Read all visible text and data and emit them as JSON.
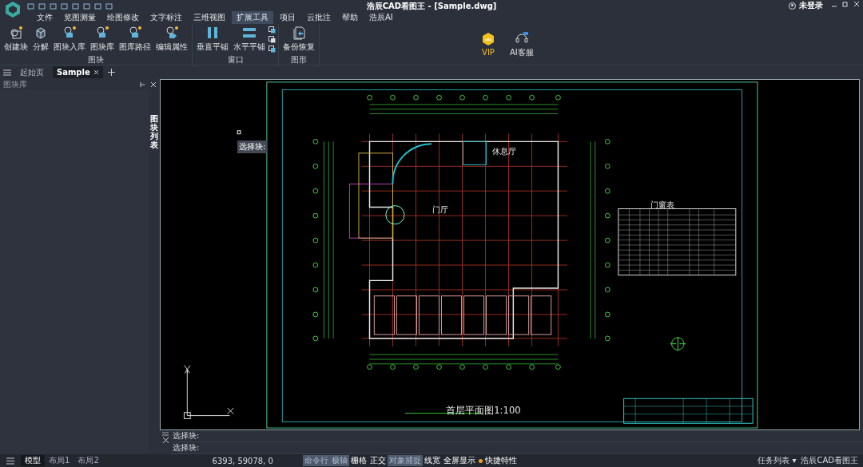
{
  "window": {
    "title": "浩辰CAD看图王 - [Sample.dwg]",
    "user": "未登录"
  },
  "menu": [
    {
      "label": "文件",
      "selected": false
    },
    {
      "label": "览图测量",
      "selected": false
    },
    {
      "label": "绘图修改",
      "selected": false
    },
    {
      "label": "文字标注",
      "selected": false
    },
    {
      "label": "三维视图",
      "selected": false
    },
    {
      "label": "扩展工具",
      "selected": true
    },
    {
      "label": "项目",
      "selected": false
    },
    {
      "label": "云批注",
      "selected": false
    },
    {
      "label": "帮助",
      "selected": false
    },
    {
      "label": "浩辰AI",
      "selected": false
    }
  ],
  "ribbon": [
    {
      "title": "图块",
      "buttons": [
        {
          "label": "创建块",
          "kind": "block"
        },
        {
          "label": "分解",
          "kind": "cube"
        },
        {
          "label": "图块入库",
          "kind": "db"
        },
        {
          "label": "图块库",
          "kind": "db"
        },
        {
          "label": "图库路径",
          "kind": "db"
        },
        {
          "label": "编辑属性",
          "kind": "tag"
        }
      ]
    },
    {
      "title": "窗口",
      "buttons": [
        {
          "label": "垂直平铺",
          "kind": "vertical"
        },
        {
          "label": "水平平铺",
          "kind": "horizontal"
        },
        {
          "kind": "small"
        }
      ]
    },
    {
      "title": "图形",
      "buttons": [
        {
          "label": "备份恢复",
          "kind": "backup"
        }
      ]
    }
  ],
  "extras": [
    {
      "label": "VIP",
      "kind": "vip"
    },
    {
      "label": "AI客服",
      "kind": "support"
    }
  ],
  "doc_tabs": [
    {
      "label": "起始页",
      "selected": false,
      "closable": false
    },
    {
      "label": "Sample",
      "selected": true,
      "closable": true
    }
  ],
  "left_panel": {
    "title": "图块库",
    "side_tab": "图块列表"
  },
  "canvas": {
    "tooltip": "选择块:",
    "labels": [
      {
        "text": "休息厅",
        "kind": "room"
      },
      {
        "text": "门厅",
        "kind": "room"
      },
      {
        "text": "首层平面图1:100",
        "kind": "title"
      },
      {
        "text": "门窗表",
        "kind": "table"
      }
    ]
  },
  "command_lines": [
    "选择块:",
    "选择块:"
  ],
  "layout_tabs": [
    {
      "label": "模型",
      "selected": true
    },
    {
      "label": "布局1",
      "selected": false
    },
    {
      "label": "布局2",
      "selected": false
    }
  ],
  "coordinates": "6393, 59078, 0",
  "toggles": [
    {
      "label": "命令行",
      "on": true
    },
    {
      "label": "极轴",
      "on": true
    },
    {
      "label": "栅格",
      "on": false
    },
    {
      "label": "正交",
      "on": false
    },
    {
      "label": "对象捕捉",
      "on": true
    },
    {
      "label": "线宽",
      "on": false
    },
    {
      "label": "全屏显示",
      "on": false
    },
    {
      "label": "快捷特性",
      "kind": "dot"
    }
  ],
  "task_list": "任务列表 ▾",
  "app_name": "浩辰CAD看图王"
}
